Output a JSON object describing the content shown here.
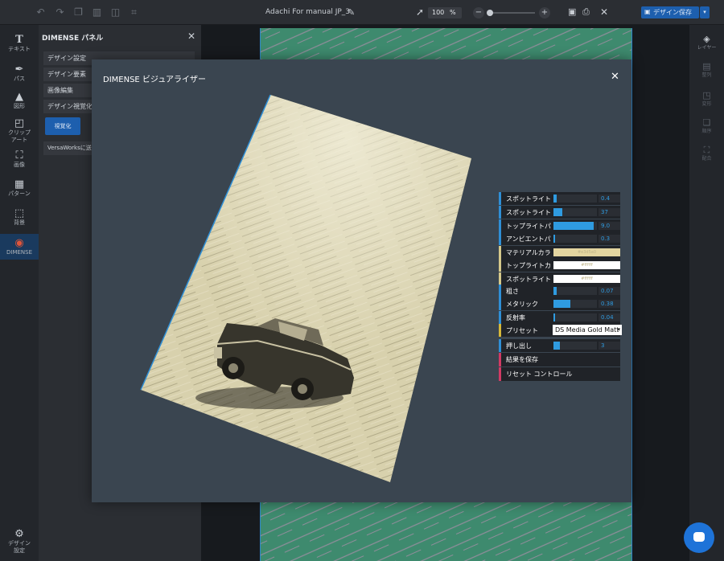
{
  "app": {
    "doc_title": "Adachi For manual JP_3",
    "zoom_value": "100",
    "zoom_unit": "%",
    "save_design_label": "デザイン保存"
  },
  "left_toolbar": [
    {
      "icon": "text-icon",
      "label": "テキスト"
    },
    {
      "icon": "pen-icon",
      "label": "パス"
    },
    {
      "icon": "shapes-icon",
      "label": "図形"
    },
    {
      "icon": "clipart-icon",
      "label": "クリップ\nアート"
    },
    {
      "icon": "image-icon",
      "label": "画像"
    },
    {
      "icon": "pattern-icon",
      "label": "パターン"
    },
    {
      "icon": "background-icon",
      "label": "背景"
    },
    {
      "icon": "dimense-icon",
      "label": "DIMENSE"
    }
  ],
  "left_toolbar_bottom": {
    "icon": "gear-icon",
    "label": "デザイン\n設定"
  },
  "panel": {
    "title": "DIMENSE パネル",
    "rows": [
      "デザイン設定",
      "デザイン要素",
      "画像編集",
      "デザイン視覚化"
    ],
    "visualize_label": "視覚化",
    "versaworks_label": "VersaWorksに送"
  },
  "right_toolbar": [
    {
      "icon": "layers-icon",
      "label": "レイヤー",
      "dim": false
    },
    {
      "icon": "align-icon",
      "label": "整列",
      "dim": true
    },
    {
      "icon": "transform-icon",
      "label": "変形",
      "dim": true
    },
    {
      "icon": "order-icon",
      "label": "順序",
      "dim": true
    },
    {
      "icon": "group-icon",
      "label": "配合",
      "dim": true
    }
  ],
  "modal": {
    "title": "DIMENSE ビジュアライザー",
    "controls": [
      {
        "type": "slider",
        "label": "スポットライトバ",
        "fill": 0.07,
        "value": "0.4"
      },
      {
        "type": "slider",
        "label": "スポットライトア",
        "fill": 0.2,
        "value": "37"
      },
      {
        "type": "slider",
        "label": "トップライトパ",
        "fill": 0.92,
        "value": "9.0"
      },
      {
        "type": "slider",
        "label": "アンビエントパ",
        "fill": 0.03,
        "value": "0.3"
      },
      {
        "type": "color",
        "label": "マテリアルカラー",
        "value": "#e3d5a0",
        "text": "#e3d5a0"
      },
      {
        "type": "color",
        "label": "トップライトカラ",
        "value": "#ffffff",
        "text": "#ffffff"
      },
      {
        "type": "color",
        "label": "スポットライトカ",
        "value": "#ffffff",
        "text": "#ffffff"
      },
      {
        "type": "slider",
        "label": "粗さ",
        "fill": 0.07,
        "value": "0.07"
      },
      {
        "type": "slider",
        "label": "メタリック",
        "fill": 0.38,
        "value": "0.38"
      },
      {
        "type": "slider",
        "label": "反射率",
        "fill": 0.04,
        "value": "0.04"
      },
      {
        "type": "select",
        "label": "プリセット",
        "value": "DS Media Gold Matt"
      },
      {
        "type": "slider",
        "label": "押し出し",
        "fill": 0.15,
        "value": "3"
      },
      {
        "type": "button",
        "label": "結果を保存"
      },
      {
        "type": "button",
        "label": "リセット コントロール"
      }
    ]
  },
  "colors": {
    "accent": "#1d5fae",
    "slider_fill": "#2f9be0",
    "artboard": "#3e8a6e",
    "modal_bg": "#3a4550",
    "material_color": "#e3d5a0"
  }
}
